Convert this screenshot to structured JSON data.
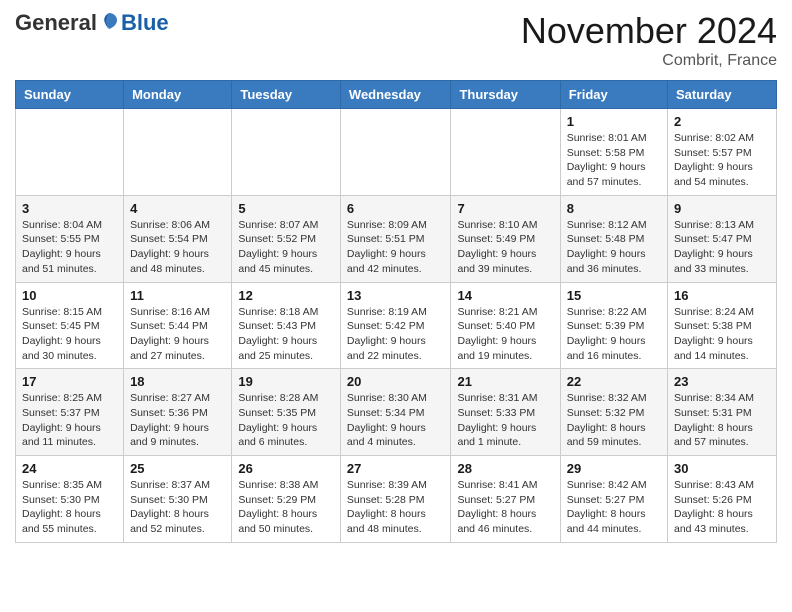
{
  "header": {
    "logo": {
      "general": "General",
      "blue": "Blue"
    },
    "title": "November 2024",
    "location": "Combrit, France"
  },
  "weekdays": [
    "Sunday",
    "Monday",
    "Tuesday",
    "Wednesday",
    "Thursday",
    "Friday",
    "Saturday"
  ],
  "weeks": [
    {
      "days": [
        {
          "date": "",
          "info": ""
        },
        {
          "date": "",
          "info": ""
        },
        {
          "date": "",
          "info": ""
        },
        {
          "date": "",
          "info": ""
        },
        {
          "date": "",
          "info": ""
        },
        {
          "date": "1",
          "info": "Sunrise: 8:01 AM\nSunset: 5:58 PM\nDaylight: 9 hours and 57 minutes."
        },
        {
          "date": "2",
          "info": "Sunrise: 8:02 AM\nSunset: 5:57 PM\nDaylight: 9 hours and 54 minutes."
        }
      ]
    },
    {
      "days": [
        {
          "date": "3",
          "info": "Sunrise: 8:04 AM\nSunset: 5:55 PM\nDaylight: 9 hours and 51 minutes."
        },
        {
          "date": "4",
          "info": "Sunrise: 8:06 AM\nSunset: 5:54 PM\nDaylight: 9 hours and 48 minutes."
        },
        {
          "date": "5",
          "info": "Sunrise: 8:07 AM\nSunset: 5:52 PM\nDaylight: 9 hours and 45 minutes."
        },
        {
          "date": "6",
          "info": "Sunrise: 8:09 AM\nSunset: 5:51 PM\nDaylight: 9 hours and 42 minutes."
        },
        {
          "date": "7",
          "info": "Sunrise: 8:10 AM\nSunset: 5:49 PM\nDaylight: 9 hours and 39 minutes."
        },
        {
          "date": "8",
          "info": "Sunrise: 8:12 AM\nSunset: 5:48 PM\nDaylight: 9 hours and 36 minutes."
        },
        {
          "date": "9",
          "info": "Sunrise: 8:13 AM\nSunset: 5:47 PM\nDaylight: 9 hours and 33 minutes."
        }
      ]
    },
    {
      "days": [
        {
          "date": "10",
          "info": "Sunrise: 8:15 AM\nSunset: 5:45 PM\nDaylight: 9 hours and 30 minutes."
        },
        {
          "date": "11",
          "info": "Sunrise: 8:16 AM\nSunset: 5:44 PM\nDaylight: 9 hours and 27 minutes."
        },
        {
          "date": "12",
          "info": "Sunrise: 8:18 AM\nSunset: 5:43 PM\nDaylight: 9 hours and 25 minutes."
        },
        {
          "date": "13",
          "info": "Sunrise: 8:19 AM\nSunset: 5:42 PM\nDaylight: 9 hours and 22 minutes."
        },
        {
          "date": "14",
          "info": "Sunrise: 8:21 AM\nSunset: 5:40 PM\nDaylight: 9 hours and 19 minutes."
        },
        {
          "date": "15",
          "info": "Sunrise: 8:22 AM\nSunset: 5:39 PM\nDaylight: 9 hours and 16 minutes."
        },
        {
          "date": "16",
          "info": "Sunrise: 8:24 AM\nSunset: 5:38 PM\nDaylight: 9 hours and 14 minutes."
        }
      ]
    },
    {
      "days": [
        {
          "date": "17",
          "info": "Sunrise: 8:25 AM\nSunset: 5:37 PM\nDaylight: 9 hours and 11 minutes."
        },
        {
          "date": "18",
          "info": "Sunrise: 8:27 AM\nSunset: 5:36 PM\nDaylight: 9 hours and 9 minutes."
        },
        {
          "date": "19",
          "info": "Sunrise: 8:28 AM\nSunset: 5:35 PM\nDaylight: 9 hours and 6 minutes."
        },
        {
          "date": "20",
          "info": "Sunrise: 8:30 AM\nSunset: 5:34 PM\nDaylight: 9 hours and 4 minutes."
        },
        {
          "date": "21",
          "info": "Sunrise: 8:31 AM\nSunset: 5:33 PM\nDaylight: 9 hours and 1 minute."
        },
        {
          "date": "22",
          "info": "Sunrise: 8:32 AM\nSunset: 5:32 PM\nDaylight: 8 hours and 59 minutes."
        },
        {
          "date": "23",
          "info": "Sunrise: 8:34 AM\nSunset: 5:31 PM\nDaylight: 8 hours and 57 minutes."
        }
      ]
    },
    {
      "days": [
        {
          "date": "24",
          "info": "Sunrise: 8:35 AM\nSunset: 5:30 PM\nDaylight: 8 hours and 55 minutes."
        },
        {
          "date": "25",
          "info": "Sunrise: 8:37 AM\nSunset: 5:30 PM\nDaylight: 8 hours and 52 minutes."
        },
        {
          "date": "26",
          "info": "Sunrise: 8:38 AM\nSunset: 5:29 PM\nDaylight: 8 hours and 50 minutes."
        },
        {
          "date": "27",
          "info": "Sunrise: 8:39 AM\nSunset: 5:28 PM\nDaylight: 8 hours and 48 minutes."
        },
        {
          "date": "28",
          "info": "Sunrise: 8:41 AM\nSunset: 5:27 PM\nDaylight: 8 hours and 46 minutes."
        },
        {
          "date": "29",
          "info": "Sunrise: 8:42 AM\nSunset: 5:27 PM\nDaylight: 8 hours and 44 minutes."
        },
        {
          "date": "30",
          "info": "Sunrise: 8:43 AM\nSunset: 5:26 PM\nDaylight: 8 hours and 43 minutes."
        }
      ]
    }
  ]
}
